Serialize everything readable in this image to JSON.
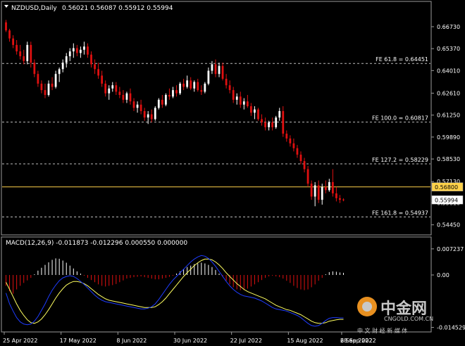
{
  "window": {
    "title": "NZDUSD,Daily",
    "ohlc": "0.56021 0.56087 0.55912 0.55994"
  },
  "price_axis": {
    "ticks": [
      "0.66730",
      "0.65370",
      "0.64010",
      "0.62610",
      "0.61250",
      "0.59890",
      "0.58530",
      "0.57130",
      "0.55810",
      "0.54450"
    ],
    "current_price": "0.55994",
    "hline_price": "0.56800"
  },
  "fib_levels": [
    {
      "label": "FE 61.8 = 0.64451",
      "price": 0.64451
    },
    {
      "label": "FE 100.0 = 0.60817",
      "price": 0.60817
    },
    {
      "label": "FE 127.2 = 0.58229",
      "price": 0.58229
    },
    {
      "label": "FE 161.8 = 0.54937",
      "price": 0.54937
    }
  ],
  "macd_panel": {
    "header": "MACD(12,26,9) -0.011873 -0.012296 0.000550 0.000000",
    "ticks": [
      "0.007237",
      "0.00",
      "-0.014529"
    ]
  },
  "date_axis": [
    "25 Apr 2022",
    "17 May 2022",
    "8 Jun 2022",
    "30 Jun 2022",
    "22 Jul 2022",
    "15 Aug 2022",
    "6 Sep 2022",
    "28 Sep 2022"
  ],
  "watermark": {
    "main": "中金网",
    "url": "CNGOLD.COM.CN",
    "sub": "中 文 财 经 新 媒 体"
  },
  "colors": {
    "background": "#000000",
    "bull": "#ffffff",
    "bear": "#e01010",
    "macd_signal": "#ffff60",
    "macd_main": "#1e3cff",
    "hline": "#ffd24a"
  },
  "chart_data": [
    {
      "type": "candlestick",
      "title": "NZDUSD,Daily",
      "ylim": [
        0.54,
        0.676
      ],
      "candles": [
        {
          "o": 0.67,
          "h": 0.6715,
          "l": 0.664,
          "c": 0.665
        },
        {
          "o": 0.665,
          "h": 0.666,
          "l": 0.658,
          "c": 0.66
        },
        {
          "o": 0.66,
          "h": 0.662,
          "l": 0.654,
          "c": 0.656
        },
        {
          "o": 0.656,
          "h": 0.659,
          "l": 0.65,
          "c": 0.652
        },
        {
          "o": 0.652,
          "h": 0.656,
          "l": 0.647,
          "c": 0.649
        },
        {
          "o": 0.649,
          "h": 0.653,
          "l": 0.644,
          "c": 0.646
        },
        {
          "o": 0.646,
          "h": 0.658,
          "l": 0.644,
          "c": 0.656
        },
        {
          "o": 0.656,
          "h": 0.658,
          "l": 0.642,
          "c": 0.645
        },
        {
          "o": 0.645,
          "h": 0.647,
          "l": 0.636,
          "c": 0.638
        },
        {
          "o": 0.638,
          "h": 0.64,
          "l": 0.63,
          "c": 0.632
        },
        {
          "o": 0.632,
          "h": 0.634,
          "l": 0.626,
          "c": 0.628
        },
        {
          "o": 0.628,
          "h": 0.632,
          "l": 0.623,
          "c": 0.625
        },
        {
          "o": 0.625,
          "h": 0.634,
          "l": 0.624,
          "c": 0.632
        },
        {
          "o": 0.632,
          "h": 0.636,
          "l": 0.628,
          "c": 0.63
        },
        {
          "o": 0.63,
          "h": 0.64,
          "l": 0.629,
          "c": 0.638
        },
        {
          "o": 0.638,
          "h": 0.642,
          "l": 0.633,
          "c": 0.641
        },
        {
          "o": 0.641,
          "h": 0.647,
          "l": 0.639,
          "c": 0.645
        },
        {
          "o": 0.645,
          "h": 0.651,
          "l": 0.642,
          "c": 0.649
        },
        {
          "o": 0.649,
          "h": 0.654,
          "l": 0.646,
          "c": 0.652
        },
        {
          "o": 0.652,
          "h": 0.657,
          "l": 0.648,
          "c": 0.654
        },
        {
          "o": 0.654,
          "h": 0.656,
          "l": 0.649,
          "c": 0.651
        },
        {
          "o": 0.651,
          "h": 0.655,
          "l": 0.648,
          "c": 0.653
        },
        {
          "o": 0.653,
          "h": 0.658,
          "l": 0.65,
          "c": 0.655
        },
        {
          "o": 0.655,
          "h": 0.657,
          "l": 0.648,
          "c": 0.65
        },
        {
          "o": 0.65,
          "h": 0.652,
          "l": 0.642,
          "c": 0.644
        },
        {
          "o": 0.644,
          "h": 0.647,
          "l": 0.638,
          "c": 0.641
        },
        {
          "o": 0.641,
          "h": 0.645,
          "l": 0.635,
          "c": 0.637
        },
        {
          "o": 0.637,
          "h": 0.64,
          "l": 0.63,
          "c": 0.632
        },
        {
          "o": 0.632,
          "h": 0.634,
          "l": 0.624,
          "c": 0.626
        },
        {
          "o": 0.626,
          "h": 0.631,
          "l": 0.622,
          "c": 0.629
        },
        {
          "o": 0.629,
          "h": 0.633,
          "l": 0.627,
          "c": 0.631
        },
        {
          "o": 0.631,
          "h": 0.633,
          "l": 0.625,
          "c": 0.627
        },
        {
          "o": 0.627,
          "h": 0.63,
          "l": 0.623,
          "c": 0.625
        },
        {
          "o": 0.625,
          "h": 0.628,
          "l": 0.62,
          "c": 0.622
        },
        {
          "o": 0.622,
          "h": 0.627,
          "l": 0.62,
          "c": 0.626
        },
        {
          "o": 0.626,
          "h": 0.629,
          "l": 0.619,
          "c": 0.621
        },
        {
          "o": 0.621,
          "h": 0.623,
          "l": 0.615,
          "c": 0.617
        },
        {
          "o": 0.617,
          "h": 0.621,
          "l": 0.614,
          "c": 0.619
        },
        {
          "o": 0.619,
          "h": 0.622,
          "l": 0.613,
          "c": 0.615
        },
        {
          "o": 0.615,
          "h": 0.617,
          "l": 0.609,
          "c": 0.611
        },
        {
          "o": 0.611,
          "h": 0.615,
          "l": 0.607,
          "c": 0.613
        },
        {
          "o": 0.613,
          "h": 0.616,
          "l": 0.608,
          "c": 0.61
        },
        {
          "o": 0.61,
          "h": 0.618,
          "l": 0.609,
          "c": 0.617
        },
        {
          "o": 0.617,
          "h": 0.623,
          "l": 0.616,
          "c": 0.622
        },
        {
          "o": 0.622,
          "h": 0.625,
          "l": 0.617,
          "c": 0.619
        },
        {
          "o": 0.619,
          "h": 0.626,
          "l": 0.618,
          "c": 0.625
        },
        {
          "o": 0.625,
          "h": 0.629,
          "l": 0.622,
          "c": 0.624
        },
        {
          "o": 0.624,
          "h": 0.63,
          "l": 0.623,
          "c": 0.628
        },
        {
          "o": 0.628,
          "h": 0.631,
          "l": 0.624,
          "c": 0.626
        },
        {
          "o": 0.626,
          "h": 0.633,
          "l": 0.625,
          "c": 0.632
        },
        {
          "o": 0.632,
          "h": 0.635,
          "l": 0.628,
          "c": 0.63
        },
        {
          "o": 0.63,
          "h": 0.637,
          "l": 0.629,
          "c": 0.634
        },
        {
          "o": 0.634,
          "h": 0.636,
          "l": 0.628,
          "c": 0.629
        },
        {
          "o": 0.629,
          "h": 0.634,
          "l": 0.627,
          "c": 0.633
        },
        {
          "o": 0.633,
          "h": 0.635,
          "l": 0.627,
          "c": 0.628
        },
        {
          "o": 0.628,
          "h": 0.631,
          "l": 0.625,
          "c": 0.627
        },
        {
          "o": 0.627,
          "h": 0.633,
          "l": 0.626,
          "c": 0.632
        },
        {
          "o": 0.632,
          "h": 0.642,
          "l": 0.631,
          "c": 0.64
        },
        {
          "o": 0.64,
          "h": 0.646,
          "l": 0.638,
          "c": 0.644
        },
        {
          "o": 0.644,
          "h": 0.647,
          "l": 0.636,
          "c": 0.638
        },
        {
          "o": 0.638,
          "h": 0.645,
          "l": 0.636,
          "c": 0.643
        },
        {
          "o": 0.643,
          "h": 0.645,
          "l": 0.634,
          "c": 0.635
        },
        {
          "o": 0.635,
          "h": 0.638,
          "l": 0.629,
          "c": 0.631
        },
        {
          "o": 0.631,
          "h": 0.634,
          "l": 0.626,
          "c": 0.628
        },
        {
          "o": 0.628,
          "h": 0.63,
          "l": 0.62,
          "c": 0.622
        },
        {
          "o": 0.622,
          "h": 0.626,
          "l": 0.619,
          "c": 0.624
        },
        {
          "o": 0.624,
          "h": 0.627,
          "l": 0.617,
          "c": 0.619
        },
        {
          "o": 0.619,
          "h": 0.623,
          "l": 0.616,
          "c": 0.621
        },
        {
          "o": 0.621,
          "h": 0.625,
          "l": 0.617,
          "c": 0.618
        },
        {
          "o": 0.618,
          "h": 0.62,
          "l": 0.612,
          "c": 0.614
        },
        {
          "o": 0.614,
          "h": 0.618,
          "l": 0.61,
          "c": 0.616
        },
        {
          "o": 0.616,
          "h": 0.617,
          "l": 0.609,
          "c": 0.61
        },
        {
          "o": 0.61,
          "h": 0.613,
          "l": 0.606,
          "c": 0.608
        },
        {
          "o": 0.608,
          "h": 0.611,
          "l": 0.603,
          "c": 0.605
        },
        {
          "o": 0.605,
          "h": 0.609,
          "l": 0.603,
          "c": 0.608
        },
        {
          "o": 0.608,
          "h": 0.611,
          "l": 0.603,
          "c": 0.605
        },
        {
          "o": 0.605,
          "h": 0.612,
          "l": 0.604,
          "c": 0.611
        },
        {
          "o": 0.611,
          "h": 0.617,
          "l": 0.609,
          "c": 0.615
        },
        {
          "o": 0.615,
          "h": 0.618,
          "l": 0.599,
          "c": 0.601
        },
        {
          "o": 0.601,
          "h": 0.603,
          "l": 0.596,
          "c": 0.598
        },
        {
          "o": 0.598,
          "h": 0.6,
          "l": 0.593,
          "c": 0.595
        },
        {
          "o": 0.595,
          "h": 0.598,
          "l": 0.59,
          "c": 0.592
        },
        {
          "o": 0.592,
          "h": 0.594,
          "l": 0.586,
          "c": 0.588
        },
        {
          "o": 0.588,
          "h": 0.59,
          "l": 0.582,
          "c": 0.584
        },
        {
          "o": 0.584,
          "h": 0.586,
          "l": 0.577,
          "c": 0.579
        },
        {
          "o": 0.579,
          "h": 0.581,
          "l": 0.568,
          "c": 0.57
        },
        {
          "o": 0.57,
          "h": 0.572,
          "l": 0.56,
          "c": 0.562
        },
        {
          "o": 0.562,
          "h": 0.571,
          "l": 0.556,
          "c": 0.569
        },
        {
          "o": 0.569,
          "h": 0.572,
          "l": 0.558,
          "c": 0.56
        },
        {
          "o": 0.56,
          "h": 0.57,
          "l": 0.557,
          "c": 0.568
        },
        {
          "o": 0.568,
          "h": 0.572,
          "l": 0.564,
          "c": 0.566
        },
        {
          "o": 0.566,
          "h": 0.573,
          "l": 0.565,
          "c": 0.571
        },
        {
          "o": 0.571,
          "h": 0.579,
          "l": 0.562,
          "c": 0.564
        },
        {
          "o": 0.564,
          "h": 0.568,
          "l": 0.559,
          "c": 0.561
        },
        {
          "o": 0.561,
          "h": 0.563,
          "l": 0.558,
          "c": 0.56
        },
        {
          "o": 0.5602,
          "h": 0.5609,
          "l": 0.5591,
          "c": 0.5599
        }
      ]
    },
    {
      "type": "macd",
      "title": "MACD(12,26,9)",
      "ylim": [
        -0.015,
        0.0076
      ],
      "histogram": [
        -0.003,
        -0.0045,
        -0.0052,
        -0.004,
        -0.003,
        -0.0022,
        -0.0015,
        -0.0008,
        0.0002,
        0.0012,
        0.002,
        0.0028,
        0.0035,
        0.0042,
        0.0046,
        0.0045,
        0.004,
        0.0034,
        0.0026,
        0.0018,
        0.001,
        0.0004,
        -0.0002,
        -0.0008,
        -0.0014,
        -0.002,
        -0.0026,
        -0.003,
        -0.0032,
        -0.003,
        -0.0028,
        -0.0025,
        -0.002,
        -0.0015,
        -0.001,
        -0.0008,
        -0.0006,
        -0.0005,
        -0.0004,
        -0.0006,
        -0.0008,
        -0.001,
        -0.0012,
        -0.0012,
        -0.001,
        -0.0008,
        -0.0005,
        -0.0002,
        0.0004,
        0.001,
        0.0016,
        0.0022,
        0.0026,
        0.003,
        0.0032,
        0.0034,
        0.0032,
        0.0028,
        0.0022,
        0.0014,
        0.0004,
        -0.0006,
        -0.0016,
        -0.0026,
        -0.0034,
        -0.004,
        -0.0042,
        -0.0042,
        -0.0038,
        -0.0032,
        -0.0026,
        -0.002,
        -0.0014,
        -0.0008,
        -0.0004,
        -0.0002,
        -0.0004,
        -0.0006,
        -0.001,
        -0.0016,
        -0.0022,
        -0.003,
        -0.0036,
        -0.004,
        -0.0042,
        -0.004,
        -0.0034,
        -0.0026,
        -0.0016,
        -0.0008,
        0.0002,
        0.0008,
        0.001,
        0.0009,
        0.0007,
        0.0006
      ],
      "macd": [
        -0.005,
        -0.008,
        -0.01,
        -0.0118,
        -0.013,
        -0.0136,
        -0.0138,
        -0.0136,
        -0.0128,
        -0.0115,
        -0.0098,
        -0.008,
        -0.006,
        -0.0042,
        -0.0028,
        -0.0016,
        -0.0008,
        -0.0004,
        -0.0002,
        -0.0004,
        -0.001,
        -0.0018,
        -0.0026,
        -0.0036,
        -0.0046,
        -0.0056,
        -0.0064,
        -0.007,
        -0.0074,
        -0.0076,
        -0.0078,
        -0.008,
        -0.0082,
        -0.0084,
        -0.0086,
        -0.0088,
        -0.009,
        -0.0092,
        -0.0094,
        -0.0094,
        -0.0092,
        -0.0088,
        -0.008,
        -0.0068,
        -0.0054,
        -0.004,
        -0.0026,
        -0.0014,
        -0.0004,
        0.0006,
        0.0016,
        0.0026,
        0.0036,
        0.0044,
        0.005,
        0.0054,
        0.0052,
        0.0046,
        0.0036,
        0.0024,
        0.001,
        -0.0004,
        -0.0018,
        -0.003,
        -0.004,
        -0.0048,
        -0.0054,
        -0.0058,
        -0.006,
        -0.0062,
        -0.0064,
        -0.0068,
        -0.0072,
        -0.0078,
        -0.0084,
        -0.009,
        -0.0094,
        -0.0096,
        -0.0098,
        -0.01,
        -0.0104,
        -0.0108,
        -0.0112,
        -0.0118,
        -0.0126,
        -0.0134,
        -0.014,
        -0.0142,
        -0.014,
        -0.0134,
        -0.0126,
        -0.012,
        -0.0118,
        -0.0118,
        -0.0119,
        -0.0119
      ],
      "signal": [
        -0.002,
        -0.004,
        -0.006,
        -0.008,
        -0.0098,
        -0.0112,
        -0.0124,
        -0.0132,
        -0.0134,
        -0.013,
        -0.0122,
        -0.011,
        -0.0096,
        -0.008,
        -0.0064,
        -0.005,
        -0.0038,
        -0.0028,
        -0.0022,
        -0.0018,
        -0.0018,
        -0.002,
        -0.0024,
        -0.003,
        -0.0038,
        -0.0046,
        -0.0054,
        -0.006,
        -0.0066,
        -0.007,
        -0.0072,
        -0.0074,
        -0.0076,
        -0.0078,
        -0.008,
        -0.0082,
        -0.0084,
        -0.0086,
        -0.0088,
        -0.009,
        -0.009,
        -0.009,
        -0.0088,
        -0.0082,
        -0.0074,
        -0.0064,
        -0.0052,
        -0.004,
        -0.0028,
        -0.0016,
        -0.0004,
        0.0006,
        0.0016,
        0.0026,
        0.0034,
        0.004,
        0.0044,
        0.0044,
        0.0042,
        0.0036,
        0.0028,
        0.0018,
        0.0006,
        -0.0004,
        -0.0014,
        -0.0024,
        -0.0032,
        -0.004,
        -0.0046,
        -0.005,
        -0.0054,
        -0.0058,
        -0.0062,
        -0.0066,
        -0.0072,
        -0.0078,
        -0.0084,
        -0.0088,
        -0.0092,
        -0.0096,
        -0.0098,
        -0.0102,
        -0.0106,
        -0.011,
        -0.0116,
        -0.0122,
        -0.0128,
        -0.0132,
        -0.0134,
        -0.0134,
        -0.0132,
        -0.0128,
        -0.0126,
        -0.0124,
        -0.0123,
        -0.0123
      ]
    }
  ]
}
